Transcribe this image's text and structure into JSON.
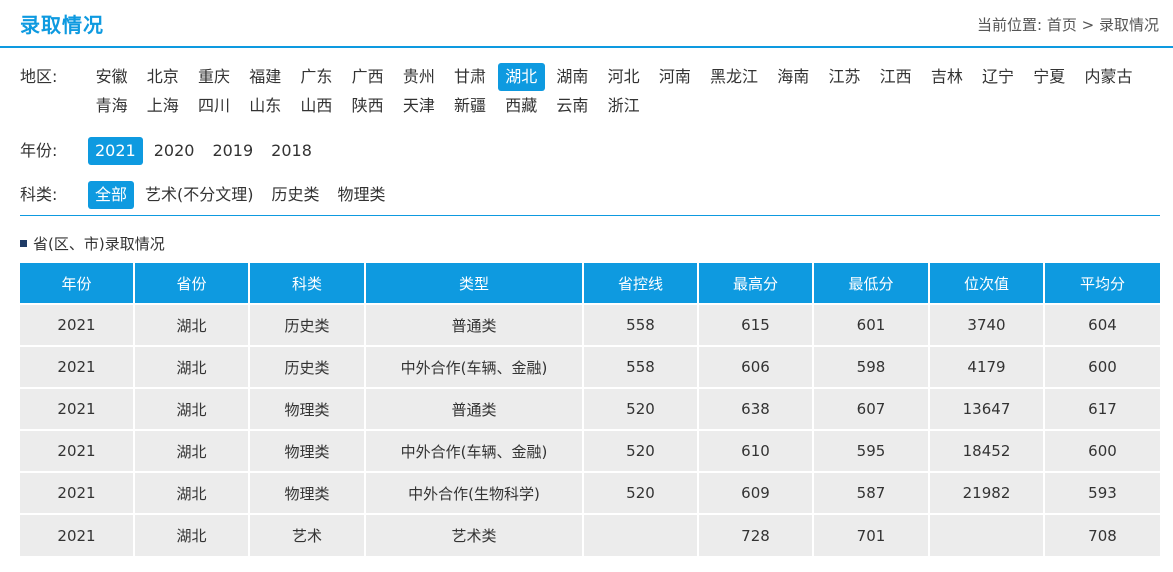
{
  "header": {
    "title": "录取情况",
    "breadcrumb_prefix": "当前位置:",
    "breadcrumb_home": "首页",
    "breadcrumb_sep": ">",
    "breadcrumb_current": "录取情况"
  },
  "filters": {
    "region_label": "地区:",
    "regions": [
      "安徽",
      "北京",
      "重庆",
      "福建",
      "广东",
      "广西",
      "贵州",
      "甘肃",
      "湖北",
      "湖南",
      "河北",
      "河南",
      "黑龙江",
      "海南",
      "江苏",
      "江西",
      "吉林",
      "辽宁",
      "宁夏",
      "内蒙古",
      "青海",
      "上海",
      "四川",
      "山东",
      "山西",
      "陕西",
      "天津",
      "新疆",
      "西藏",
      "云南",
      "浙江"
    ],
    "region_selected": "湖北",
    "year_label": "年份:",
    "years": [
      "2021",
      "2020",
      "2019",
      "2018"
    ],
    "year_selected": "2021",
    "subject_label": "科类:",
    "subjects": [
      "全部",
      "艺术(不分文理)",
      "历史类",
      "物理类"
    ],
    "subject_selected": "全部"
  },
  "section": {
    "title": "省(区、市)录取情况"
  },
  "table": {
    "headers": [
      "年份",
      "省份",
      "科类",
      "类型",
      "省控线",
      "最高分",
      "最低分",
      "位次值",
      "平均分"
    ],
    "rows": [
      [
        "2021",
        "湖北",
        "历史类",
        "普通类",
        "558",
        "615",
        "601",
        "3740",
        "604"
      ],
      [
        "2021",
        "湖北",
        "历史类",
        "中外合作(车辆、金融)",
        "558",
        "606",
        "598",
        "4179",
        "600"
      ],
      [
        "2021",
        "湖北",
        "物理类",
        "普通类",
        "520",
        "638",
        "607",
        "13647",
        "617"
      ],
      [
        "2021",
        "湖北",
        "物理类",
        "中外合作(车辆、金融)",
        "520",
        "610",
        "595",
        "18452",
        "600"
      ],
      [
        "2021",
        "湖北",
        "物理类",
        "中外合作(生物科学)",
        "520",
        "609",
        "587",
        "21982",
        "593"
      ],
      [
        "2021",
        "湖北",
        "艺术",
        "艺术类",
        "",
        "728",
        "701",
        "",
        "708"
      ]
    ]
  },
  "colors": {
    "accent": "#0e9ae0",
    "row_bg": "#ececec",
    "icon": "#1f3b66"
  }
}
